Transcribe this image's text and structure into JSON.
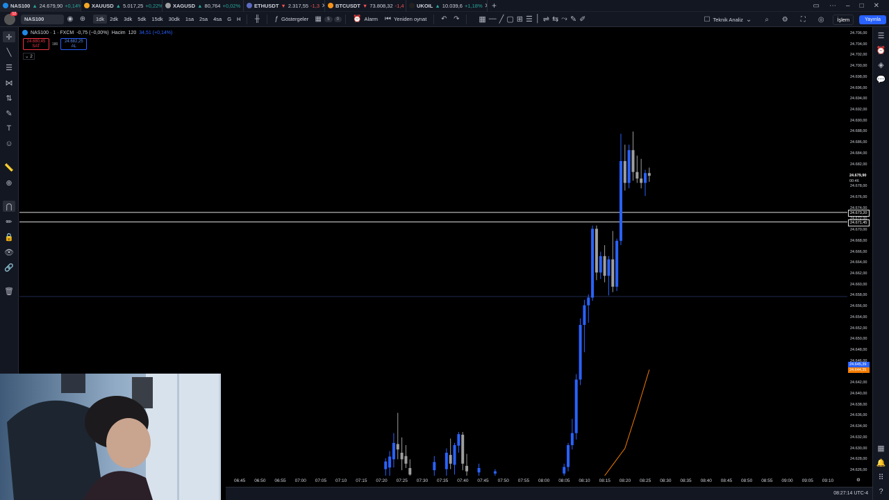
{
  "tabs": [
    {
      "symbol": "NAS100",
      "dir": "up",
      "arrow": "▲",
      "price": "24.679,90",
      "change": "+0,14%",
      "color": "#1e88e5",
      "active": true
    },
    {
      "symbol": "XAUUSD",
      "dir": "up",
      "arrow": "▲",
      "price": "5.017,25",
      "change": "+0,22%",
      "color": "#f5a623",
      "active": false
    },
    {
      "symbol": "XAGUSD",
      "dir": "up",
      "arrow": "▲",
      "price": "80,764",
      "change": "+0,02%",
      "color": "#9e9e9e",
      "active": false
    },
    {
      "symbol": "ETHUSDT",
      "dir": "down",
      "arrow": "▼",
      "price": "2.317,55",
      "change": "-1,3",
      "color": "#5c6bc0",
      "active": false
    },
    {
      "symbol": "BTCUSDT",
      "dir": "down",
      "arrow": "▼",
      "price": "73.808,32",
      "change": "-1,4",
      "color": "#f7931a",
      "active": false
    },
    {
      "symbol": "UKOIL",
      "dir": "up",
      "arrow": "▲",
      "price": "10.039,6",
      "change": "+1,18%",
      "color": "#212121",
      "active": false
    }
  ],
  "toolbar": {
    "notifications": "12",
    "symbol": "NAS100",
    "intervals": [
      "1dk",
      "2dk",
      "3dk",
      "5dk",
      "15dk",
      "30dk",
      "1sa",
      "2sa",
      "4sa",
      "G",
      "H"
    ],
    "selected_interval": "1dk",
    "indicators_label": "Göstergeler",
    "indicators_count_a": "5",
    "indicators_count_b": "0",
    "alarm_label": "Alarm",
    "replay_label": "Yeniden oynat",
    "analysis_label": "Teknik Analiz",
    "trade_label": "İşlem",
    "publish_label": "Yayınla"
  },
  "legend": {
    "title": "NAS100 · 1 · FXCM",
    "change": "-0,75 (−0,00%)",
    "volume_label": "Hacim",
    "volume_value": "120",
    "volume_extra": "34,51 (+0,14%)",
    "sell_price": "24.680,45",
    "sell_label": "SAT",
    "spread": "180",
    "buy_price": "24.682,25",
    "buy_label": "AL",
    "collapsed_count": "2"
  },
  "price_scale": {
    "ticks": [
      "24.706,00",
      "24.704,00",
      "24.702,00",
      "24.700,00",
      "24.698,00",
      "24.696,00",
      "24.694,00",
      "24.692,00",
      "24.690,00",
      "24.688,00",
      "24.686,00",
      "24.684,00",
      "24.682,00",
      "24.680,00",
      "24.678,00",
      "24.676,00",
      "24.674,00",
      "24.672,00",
      "24.670,00",
      "24.668,00",
      "24.666,00",
      "24.664,00",
      "24.662,00",
      "24.660,00",
      "24.658,00",
      "24.656,00",
      "24.654,00",
      "24.652,00",
      "24.650,00",
      "24.648,00",
      "24.646,00",
      "24.644,00",
      "24.642,00",
      "24.640,00",
      "24.638,00",
      "24.636,00",
      "24.634,00",
      "24.632,00",
      "24.630,00",
      "24.628,00",
      "24.626,00"
    ],
    "current_price": "24.679,90",
    "countdown": "00:46",
    "line_upper": "24.673,20",
    "line_lower": "24.671,45",
    "ma_blue": "24.645,39",
    "ma_orange": "24.644,35"
  },
  "time_scale": [
    "06:45",
    "06:50",
    "06:55",
    "07:00",
    "07:05",
    "07:10",
    "07:15",
    "07:20",
    "07:25",
    "07:30",
    "07:35",
    "07:40",
    "07:45",
    "07:50",
    "07:55",
    "08:00",
    "08:05",
    "08:10",
    "08:15",
    "08:20",
    "08:25",
    "08:30",
    "08:35",
    "08:40",
    "08:45",
    "08:50",
    "08:55",
    "09:00",
    "09:05",
    "09:10"
  ],
  "clock": "08:27:14 UTC-4",
  "colors": {
    "bull": "#2962ff",
    "bear": "#9e9e9e",
    "accent": "#2962ff",
    "ma_orange": "#f57c00"
  },
  "chart_data": {
    "type": "candlestick",
    "ylim": [
      24625,
      24707
    ],
    "x_start": "06:45",
    "candles": [
      {
        "t": "07:21",
        "o": 24626.2,
        "h": 24628.2,
        "l": 24625.0,
        "c": 24627.6
      },
      {
        "t": "07:22",
        "o": 24626.5,
        "h": 24629.5,
        "l": 24625.0,
        "c": 24628.5
      },
      {
        "t": "07:23",
        "o": 24628.0,
        "h": 24632.8,
        "l": 24626.5,
        "c": 24631.0
      },
      {
        "t": "07:24",
        "o": 24630.8,
        "h": 24636.5,
        "l": 24628.0,
        "c": 24629.8
      },
      {
        "t": "07:25",
        "o": 24629.2,
        "h": 24632.0,
        "l": 24626.0,
        "c": 24628.0
      },
      {
        "t": "07:26",
        "o": 24628.6,
        "h": 24630.6,
        "l": 24626.4,
        "c": 24627.2
      },
      {
        "t": "07:27",
        "o": 24626.4,
        "h": 24628.0,
        "l": 24624.6,
        "c": 24625.2
      },
      {
        "t": "07:33",
        "o": 24626.0,
        "h": 24628.6,
        "l": 24624.6,
        "c": 24627.5
      },
      {
        "t": "07:36",
        "o": 24626.2,
        "h": 24630.0,
        "l": 24624.6,
        "c": 24629.2
      },
      {
        "t": "07:37",
        "o": 24628.8,
        "h": 24631.8,
        "l": 24626.2,
        "c": 24627.2
      },
      {
        "t": "07:38",
        "o": 24627.0,
        "h": 24631.0,
        "l": 24625.2,
        "c": 24630.6
      },
      {
        "t": "07:39",
        "o": 24630.5,
        "h": 24633.0,
        "l": 24629.2,
        "c": 24632.6
      },
      {
        "t": "07:40",
        "o": 24632.5,
        "h": 24633.0,
        "l": 24626.0,
        "c": 24627.2
      },
      {
        "t": "07:41",
        "o": 24626.8,
        "h": 24629.0,
        "l": 24624.8,
        "c": 24625.8
      },
      {
        "t": "07:44",
        "o": 24625.6,
        "h": 24627.2,
        "l": 24624.8,
        "c": 24626.4
      },
      {
        "t": "07:48",
        "o": 24625.4,
        "h": 24626.2,
        "l": 24624.8,
        "c": 24625.8
      },
      {
        "t": "08:05",
        "o": 24625.4,
        "h": 24627.2,
        "l": 24624.8,
        "c": 24626.6
      },
      {
        "t": "08:06",
        "o": 24626.6,
        "h": 24631.0,
        "l": 24625.8,
        "c": 24630.6
      },
      {
        "t": "08:07",
        "o": 24630.6,
        "h": 24635.4,
        "l": 24629.8,
        "c": 24632.8
      },
      {
        "t": "08:08",
        "o": 24632.8,
        "h": 24643.6,
        "l": 24631.6,
        "c": 24642.6
      },
      {
        "t": "08:09",
        "o": 24642.6,
        "h": 24653.8,
        "l": 24641.6,
        "c": 24652.6
      },
      {
        "t": "08:10",
        "o": 24652.6,
        "h": 24657.2,
        "l": 24647.6,
        "c": 24656.2
      },
      {
        "t": "08:11",
        "o": 24656.2,
        "h": 24658.2,
        "l": 24653.0,
        "c": 24657.6
      },
      {
        "t": "08:12",
        "o": 24657.6,
        "h": 24670.8,
        "l": 24657.0,
        "c": 24670.2
      },
      {
        "t": "08:13",
        "o": 24670.2,
        "h": 24670.8,
        "l": 24660.8,
        "c": 24662.2
      },
      {
        "t": "08:14",
        "o": 24662.2,
        "h": 24666.0,
        "l": 24661.0,
        "c": 24665.2
      },
      {
        "t": "08:15",
        "o": 24665.2,
        "h": 24667.2,
        "l": 24660.4,
        "c": 24661.6
      },
      {
        "t": "08:16",
        "o": 24661.6,
        "h": 24665.2,
        "l": 24658.0,
        "c": 24664.6
      },
      {
        "t": "08:17",
        "o": 24664.6,
        "h": 24669.8,
        "l": 24658.6,
        "c": 24659.6
      },
      {
        "t": "08:18",
        "o": 24659.6,
        "h": 24668.4,
        "l": 24658.8,
        "c": 24668.0
      },
      {
        "t": "08:19",
        "o": 24668.0,
        "h": 24687.6,
        "l": 24667.2,
        "c": 24682.6
      },
      {
        "t": "08:20",
        "o": 24682.6,
        "h": 24685.6,
        "l": 24677.2,
        "c": 24678.6
      },
      {
        "t": "08:21",
        "o": 24678.6,
        "h": 24685.6,
        "l": 24677.6,
        "c": 24684.6
      },
      {
        "t": "08:22",
        "o": 24684.6,
        "h": 24688.0,
        "l": 24679.0,
        "c": 24680.6
      },
      {
        "t": "08:23",
        "o": 24680.6,
        "h": 24683.6,
        "l": 24678.6,
        "c": 24679.4
      },
      {
        "t": "08:24",
        "o": 24679.4,
        "h": 24683.0,
        "l": 24677.6,
        "c": 24678.6
      },
      {
        "t": "08:25",
        "o": 24678.6,
        "h": 24681.0,
        "l": 24676.2,
        "c": 24680.4
      },
      {
        "t": "08:26",
        "o": 24680.4,
        "h": 24681.4,
        "l": 24678.8,
        "c": 24679.9
      }
    ],
    "hlines": [
      24673.2,
      24671.45
    ],
    "faint_hline": 24657.8,
    "ma_orange": [
      {
        "t": "08:15",
        "v": 24625.0
      },
      {
        "t": "08:20",
        "v": 24630.0
      },
      {
        "t": "08:23",
        "v": 24637.0
      },
      {
        "t": "08:26",
        "v": 24644.4
      }
    ]
  }
}
